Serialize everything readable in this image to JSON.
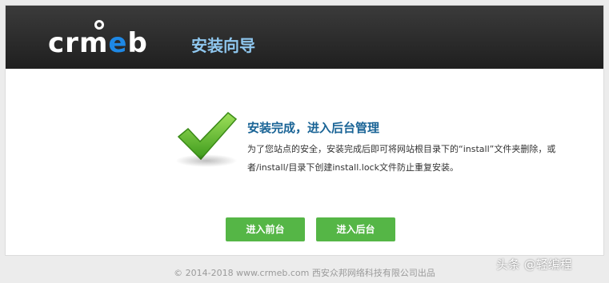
{
  "header": {
    "logo_text": "crmeb",
    "title": "安装向导"
  },
  "message": {
    "title": "安装完成，进入后台管理",
    "body": "为了您站点的安全，安装完成后即可将网站根目录下的“install”文件夹删除，或者/install/目录下创建install.lock文件防止重复安装。"
  },
  "buttons": {
    "front": "进入前台",
    "back": "进入后台"
  },
  "footer": {
    "text": "© 2014-2018 www.crmeb.com 西安众邦网络科技有限公司出品"
  },
  "watermark": {
    "text": "头条 @轻编程"
  },
  "colors": {
    "header_title": "#8fc7ef",
    "message_title": "#1a6496",
    "button": "#55b646",
    "check": "#63b82f"
  },
  "icons": {
    "success": "check-icon"
  }
}
